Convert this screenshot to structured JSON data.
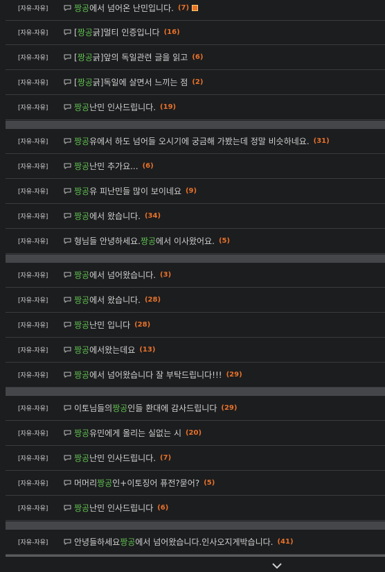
{
  "category_label": "[자유-자유]",
  "rows": [
    {
      "parts": [
        {
          "text": "짱공",
          "hl": true
        },
        {
          "text": "에서 넘어온 난민입니다.",
          "hl": false
        }
      ],
      "count": "(7)",
      "has_image": true
    },
    {
      "parts": [
        {
          "text": "[",
          "hl": false
        },
        {
          "text": "짱공",
          "hl": true
        },
        {
          "text": "긁]멀티 인증입니다",
          "hl": false
        }
      ],
      "count": "(16)",
      "has_image": false
    },
    {
      "parts": [
        {
          "text": "[",
          "hl": false
        },
        {
          "text": "짱공",
          "hl": true
        },
        {
          "text": "긁]앞의 독일관련 글을 읽고",
          "hl": false
        }
      ],
      "count": "(6)",
      "has_image": false
    },
    {
      "parts": [
        {
          "text": "[",
          "hl": false
        },
        {
          "text": "짱공",
          "hl": true
        },
        {
          "text": "긁]독일에 살면서 느끼는 점",
          "hl": false
        }
      ],
      "count": "(2)",
      "has_image": false
    },
    {
      "parts": [
        {
          "text": "짱공",
          "hl": true
        },
        {
          "text": " 난민 인사드립니다.",
          "hl": false
        }
      ],
      "count": "(19)",
      "has_image": false
    },
    {
      "parts": [
        {
          "text": "짱공",
          "hl": true
        },
        {
          "text": "유에서 하도 넘어들 오시기에 궁금해 가봤는데 정말 비슷하네요.",
          "hl": false
        }
      ],
      "count": "(31)",
      "has_image": false
    },
    {
      "parts": [
        {
          "text": "짱공",
          "hl": true
        },
        {
          "text": "난민 추가요...",
          "hl": false
        }
      ],
      "count": "(6)",
      "has_image": false
    },
    {
      "parts": [
        {
          "text": "짱공",
          "hl": true
        },
        {
          "text": "유 피난민들 많이 보이네요",
          "hl": false
        }
      ],
      "count": "(9)",
      "has_image": false
    },
    {
      "parts": [
        {
          "text": "짱공",
          "hl": true
        },
        {
          "text": "에서 왔습니다.",
          "hl": false
        }
      ],
      "count": "(34)",
      "has_image": false
    },
    {
      "parts": [
        {
          "text": "형님들 안녕하세요. ",
          "hl": false
        },
        {
          "text": "짱공",
          "hl": true
        },
        {
          "text": "에서 이사왔어요.",
          "hl": false
        }
      ],
      "count": "(5)",
      "has_image": false
    },
    {
      "parts": [
        {
          "text": "짱공",
          "hl": true
        },
        {
          "text": "에서 넘어왔습니다.",
          "hl": false
        }
      ],
      "count": "(3)",
      "has_image": false
    },
    {
      "parts": [
        {
          "text": "짱공",
          "hl": true
        },
        {
          "text": "에서 왔습니다.",
          "hl": false
        }
      ],
      "count": "(28)",
      "has_image": false
    },
    {
      "parts": [
        {
          "text": "짱공",
          "hl": true
        },
        {
          "text": "난민 입니다",
          "hl": false
        }
      ],
      "count": "(28)",
      "has_image": false
    },
    {
      "parts": [
        {
          "text": "짱공",
          "hl": true
        },
        {
          "text": "에서왔는데요",
          "hl": false
        }
      ],
      "count": "(13)",
      "has_image": false
    },
    {
      "parts": [
        {
          "text": "짱공",
          "hl": true
        },
        {
          "text": "에서 넘어왔습니다 잘 부탁드립니다!!!",
          "hl": false
        }
      ],
      "count": "(29)",
      "has_image": false
    },
    {
      "parts": [
        {
          "text": "이토님들의 ",
          "hl": false
        },
        {
          "text": "짱공",
          "hl": true
        },
        {
          "text": "인들 환대에 감사드립니다",
          "hl": false
        }
      ],
      "count": "(29)",
      "has_image": false
    },
    {
      "parts": [
        {
          "text": "짱공",
          "hl": true
        },
        {
          "text": "유민에게 올리는 실없는 시",
          "hl": false
        }
      ],
      "count": "(20)",
      "has_image": false
    },
    {
      "parts": [
        {
          "text": "짱공",
          "hl": true
        },
        {
          "text": " 난민 인사드립니다.",
          "hl": false
        }
      ],
      "count": "(7)",
      "has_image": false
    },
    {
      "parts": [
        {
          "text": "머머리 ",
          "hl": false
        },
        {
          "text": "짱공",
          "hl": true
        },
        {
          "text": "인+이토징어 퓨전?묻어?",
          "hl": false
        }
      ],
      "count": "(5)",
      "has_image": false
    },
    {
      "parts": [
        {
          "text": "짱공",
          "hl": true
        },
        {
          "text": " 난민 인사드립니다",
          "hl": false
        }
      ],
      "count": "(6)",
      "has_image": false
    },
    {
      "parts": [
        {
          "text": "안녕들하세요 ",
          "hl": false
        },
        {
          "text": "짱공",
          "hl": true
        },
        {
          "text": "에서 넘어왔습니다.인사오지게박습니다.",
          "hl": false
        }
      ],
      "count": "(41)",
      "has_image": false
    }
  ],
  "icons": {
    "chat": "chat-bubble-icon",
    "image": "image-attachment-icon",
    "more": "chevron-down-icon"
  },
  "colors": {
    "background": "#1c1d1f",
    "highlight": "#5fbf4f",
    "count": "#e8722a",
    "separator": "#45464a"
  }
}
